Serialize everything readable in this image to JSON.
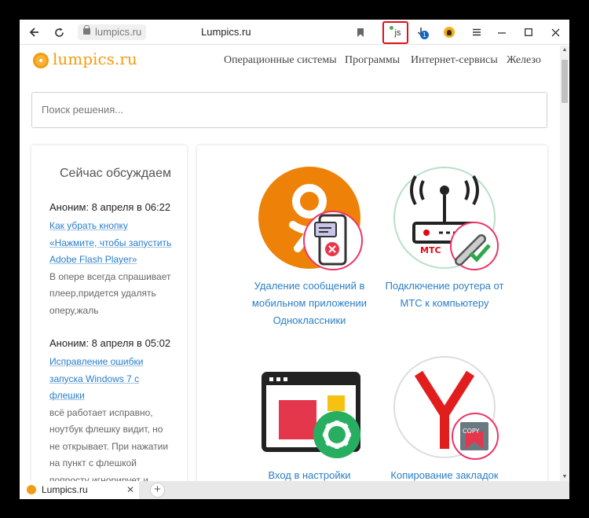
{
  "browser": {
    "url": "lumpics.ru",
    "title": "Lumpics.ru",
    "js_extension_label": "js",
    "download_badge": "1",
    "tab": {
      "label": "Lumpics.ru"
    },
    "new_tab_label": "+"
  },
  "site": {
    "logo": "lumpics.ru",
    "nav": [
      "Операционные системы",
      "Программы",
      "Интернет-сервисы",
      "Железо"
    ],
    "search_placeholder": "Поиск решения..."
  },
  "sidebar": {
    "title": "Сейчас обсуждаем",
    "comments": [
      {
        "head": "Аноним: 8 апреля в 06:22",
        "link": "Как убрать кнопку «Нажмите, чтобы запустить Adobe Flash Player»",
        "text": "В опере всегда спрашивает плеер,придется удалять оперу,жаль"
      },
      {
        "head": "Аноним: 8 апреля в 05:02",
        "link": "Исправление ошибки запуска Windows 7 с флешки",
        "text": "всё работает исправно, ноутбук флешку видит, но не открывает. При нажатии на пункт с флешкой попросту игнорирует и опять перенаправляет на меню с"
      }
    ]
  },
  "articles": [
    {
      "caption": "Удаление сообщений в мобильном приложении Одноклассники",
      "icon": "odnoklassniki-phone-icon"
    },
    {
      "caption": "Подключение роутера от МТС к компьютеру",
      "icon": "mts-router-icon",
      "brand_label": "МТС"
    },
    {
      "caption": "Вход в настройки",
      "icon": "settings-window-icon"
    },
    {
      "caption": "Копирование закладок",
      "icon": "yandex-browser-copy-icon",
      "badge_label": "COPY"
    }
  ],
  "colors": {
    "accent": "#f39c12",
    "link": "#2a7ec8",
    "highlight": "#e0101a",
    "ok_orange": "#ee8208"
  }
}
